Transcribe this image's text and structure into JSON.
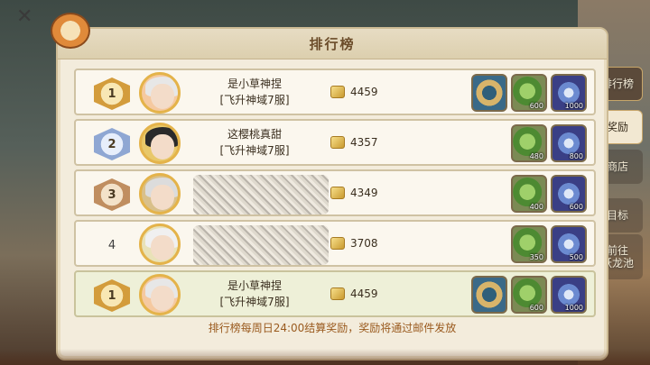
{
  "panel": {
    "title": "排行榜"
  },
  "side_tabs": [
    {
      "label": "排行榜"
    },
    {
      "label": "奖励"
    },
    {
      "label": "商店"
    },
    {
      "label": "目标"
    },
    {
      "label": "前往\n跃龙池"
    }
  ],
  "rows": [
    {
      "rank": "1",
      "badge": "gold",
      "name": "是小草神捏",
      "server": "[飞升神域7服]",
      "score": "4459",
      "rewards": [
        {
          "type": "ring",
          "qty": ""
        },
        {
          "type": "green",
          "qty": "600"
        },
        {
          "type": "blue",
          "qty": "1000"
        }
      ]
    },
    {
      "rank": "2",
      "badge": "silver",
      "name": "这樱桃真甜",
      "server": "[飞升神域7服]",
      "score": "4357",
      "rewards": [
        {
          "type": "green",
          "qty": "480"
        },
        {
          "type": "blue",
          "qty": "800"
        }
      ]
    },
    {
      "rank": "3",
      "badge": "bronze",
      "name": "",
      "server": "",
      "score": "4349",
      "rewards": [
        {
          "type": "green",
          "qty": "400"
        },
        {
          "type": "blue",
          "qty": "600"
        }
      ]
    },
    {
      "rank": "4",
      "badge": "plain",
      "name": "",
      "server": "",
      "score": "3708",
      "rewards": [
        {
          "type": "green",
          "qty": "350"
        },
        {
          "type": "blue",
          "qty": "500"
        }
      ]
    },
    {
      "rank": "1",
      "badge": "gold",
      "name": "是小草神捏",
      "server": "[飞升神域7服]",
      "score": "4459",
      "rewards": [
        {
          "type": "ring",
          "qty": ""
        },
        {
          "type": "green",
          "qty": "600"
        },
        {
          "type": "blue",
          "qty": "1000"
        }
      ]
    }
  ],
  "footer_note": "排行榜每周日24:00结算奖励，奖励将通过邮件发放",
  "colors": {
    "panel_bg": "#f3ecdc",
    "title_text": "#6b4c2a",
    "note_text": "#9a5a1e"
  }
}
